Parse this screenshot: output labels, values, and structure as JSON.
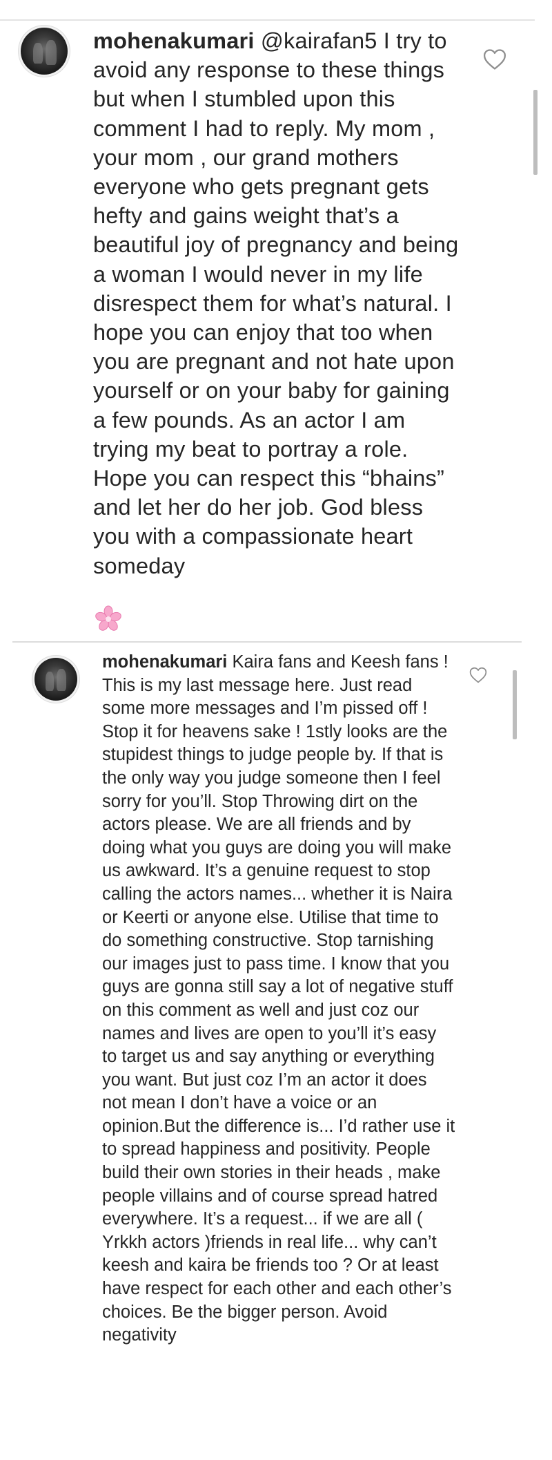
{
  "comments": [
    {
      "username": "mohenakumari",
      "mention": "@kairafan5",
      "text": " I try to avoid any response to these things but when I stumbled upon this comment I had to reply. My mom , your mom , our grand mothers everyone who gets pregnant gets hefty and gains weight that’s a beautiful joy of pregnancy and being a woman I would never in my life disrespect them for what’s natural. I hope you can enjoy that too when you are pregnant and not hate upon yourself or on your baby for gaining a few pounds. As an actor I am trying my beat to portray a role. Hope you can respect this “bhains” and let her do her job. God bless you with a compassionate heart someday",
      "emoji": "cherry-blossom-icon",
      "like_icon": "heart-outline-icon"
    },
    {
      "username": "mohenakumari",
      "mention": "",
      "text": " Kaira fans and Keesh fans ! This is my last message here. Just read some more messages and I’m pissed off ! Stop it for heavens sake ! 1stly looks are the stupidest things to judge people by. If that is the only way you judge someone then I feel sorry for you’ll. Stop Throwing dirt on the actors please. We are all friends and by doing what you guys are doing you will make us awkward. It’s a genuine request to stop calling the actors names... whether it is Naira or Keerti or anyone else. Utilise that time to do something constructive. Stop tarnishing our images just to pass time. I know that you guys are gonna still say a lot of negative stuff on this comment as well and just coz our names and lives are open to you’ll it’s easy to target us and say anything or everything you want. But just coz I’m an actor it does not mean I don’t have a voice or an opinion.But the difference is... I’d rather use it to spread happiness and positivity. People build their own stories in their heads , make people villains and of course spread hatred everywhere. It’s a request... if we are all ( Yrkkh actors )friends in real life... why can’t keesh and kaira be friends too ? Or at least have respect for each other and each other’s choices. Be the bigger person. Avoid negativity",
      "like_icon": "heart-outline-icon"
    }
  ],
  "colors": {
    "text": "#262626",
    "divider": "#e3e3e3",
    "emoji": "#f49ac1"
  }
}
